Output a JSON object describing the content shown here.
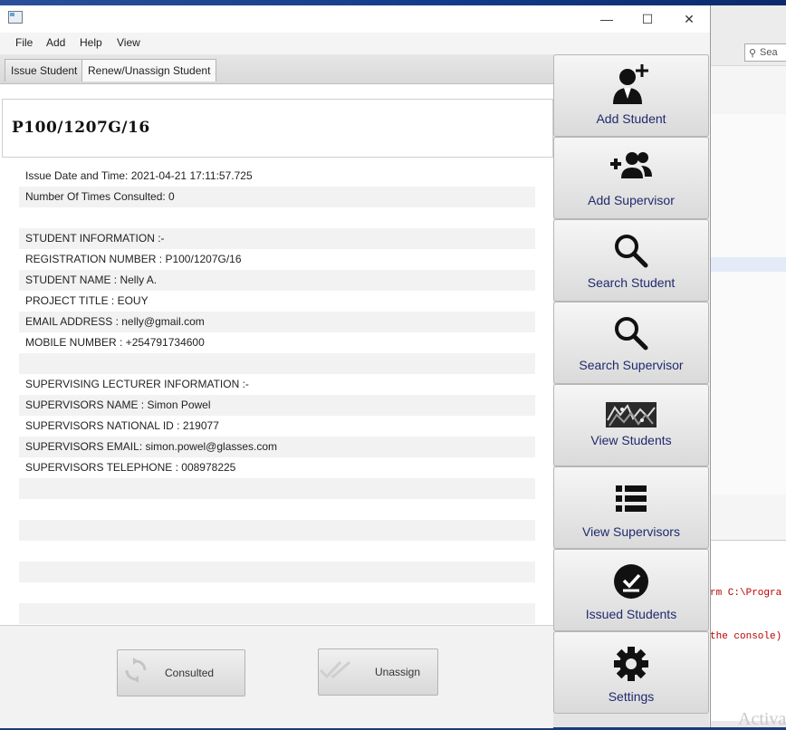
{
  "window": {
    "minimize": "—",
    "maximize": "☐",
    "close": "✕"
  },
  "menu": [
    "File",
    "Add",
    "Help",
    "View"
  ],
  "tabs": [
    "Issue Student",
    "Renew/Unassign Student"
  ],
  "record": {
    "registration_header": "P100/1207G/16",
    "lines": [
      "Issue Date and Time: 2021-04-21 17:11:57.725",
      "Number Of Times Consulted: 0",
      "",
      "STUDENT INFORMATION :-",
      "REGISTRATION NUMBER : P100/1207G/16",
      "STUDENT NAME : Nelly A.",
      "PROJECT TITLE : EOUY",
      "EMAIL ADDRESS : nelly@gmail.com",
      "MOBILE NUMBER : +254791734600",
      "",
      "SUPERVISING LECTURER INFORMATION :-",
      "SUPERVISORS NAME : Simon Powel",
      "SUPERVISORS NATIONAL ID : 219077",
      "SUPERVISORS EMAIL: simon.powel@glasses.com",
      "SUPERVISORS TELEPHONE : 008978225",
      "",
      "",
      "",
      "",
      "",
      "",
      "",
      ""
    ]
  },
  "actions": {
    "consulted": "Consulted",
    "unassign": "Unassign"
  },
  "sidebar": [
    {
      "label": "Add Student",
      "icon": "add-student-icon"
    },
    {
      "label": "Add Supervisor",
      "icon": "add-supervisor-icon"
    },
    {
      "label": "Search Student",
      "icon": "search-icon"
    },
    {
      "label": "Search Supervisor",
      "icon": "search-icon"
    },
    {
      "label": "View Students",
      "icon": "students-photo-icon"
    },
    {
      "label": "View Supervisors",
      "icon": "list-icon"
    },
    {
      "label": "Issued Students",
      "icon": "check-circle-icon"
    },
    {
      "label": "Settings",
      "icon": "gear-icon"
    }
  ],
  "background": {
    "ide_search_placeholder": "Sea",
    "console_line_1": "rm C:\\Progra",
    "console_line_2": "the console)",
    "watermark": "Activa"
  },
  "colors": {
    "sidebar_label": "#1f2a6e",
    "icon": "#111111"
  }
}
